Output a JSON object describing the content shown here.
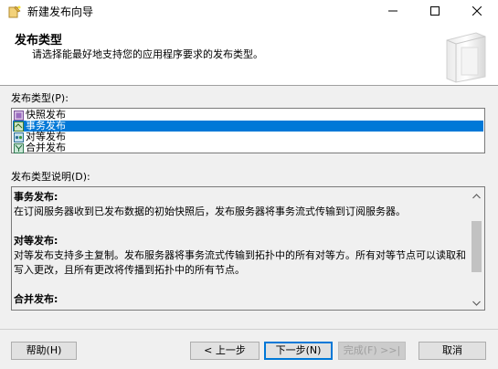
{
  "window": {
    "title": "新建发布向导"
  },
  "header": {
    "title": "发布类型",
    "subtitle": "请选择能最好地支持您的应用程序要求的发布类型。"
  },
  "type_list": {
    "label": "发布类型(P):",
    "items": [
      {
        "label": "快照发布",
        "icon": "snapshot-publication-icon",
        "selected": false
      },
      {
        "label": "事务发布",
        "icon": "transactional-publication-icon",
        "selected": true
      },
      {
        "label": "对等发布",
        "icon": "peer-to-peer-publication-icon",
        "selected": false
      },
      {
        "label": "合并发布",
        "icon": "merge-publication-icon",
        "selected": false
      }
    ]
  },
  "description": {
    "label": "发布类型说明(D):",
    "sections": [
      {
        "heading": "事务发布:",
        "body": "在订阅服务器收到已发布数据的初始快照后，发布服务器将事务流式传输到订阅服务器。"
      },
      {
        "heading": "对等发布:",
        "body": "对等发布支持多主复制。发布服务器将事务流式传输到拓扑中的所有对等方。所有对等节点可以读取和写入更改，且所有更改将传播到拓扑中的所有节点。"
      },
      {
        "heading": "合并发布:",
        "body": ""
      }
    ]
  },
  "buttons": {
    "help": "帮助(H)",
    "back": "< 上一步",
    "next": "下一步(N)",
    "finish": "完成(F) >>|",
    "cancel": "取消"
  },
  "colors": {
    "selection": "#0078d7",
    "window_bg": "#f0f0f0"
  }
}
